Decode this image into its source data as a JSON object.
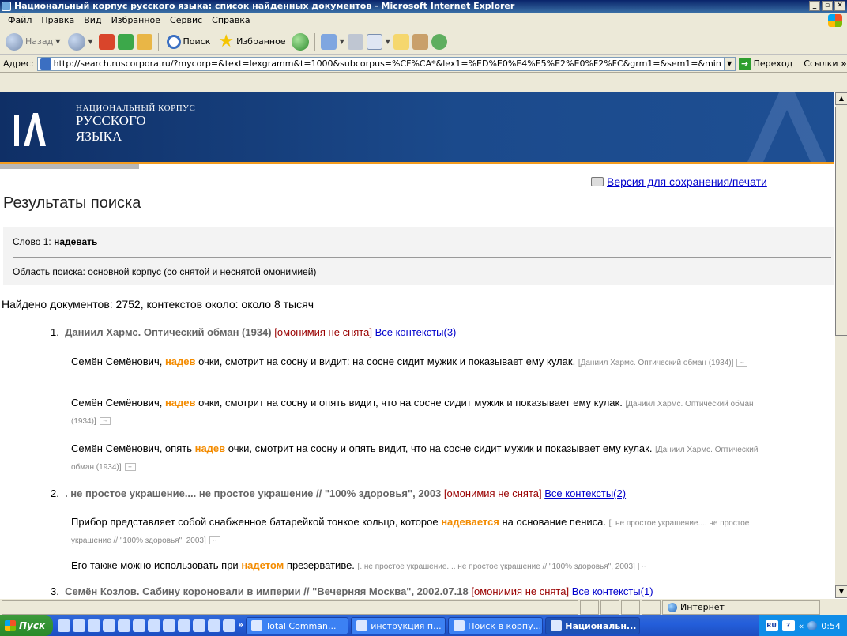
{
  "window": {
    "title": "Национальный корпус русского языка: список найденных документов - Microsoft Internet Explorer"
  },
  "menu": [
    "Файл",
    "Правка",
    "Вид",
    "Избранное",
    "Сервис",
    "Справка"
  ],
  "toolbar": {
    "back_label": "Назад",
    "search_label": "Поиск",
    "favorites_label": "Избранное"
  },
  "address": {
    "label": "Адрес:",
    "url": "http://search.ruscorpora.ru/?mycorp=&text=lexgramm&t=1000&subcorpus=%CF%CA*&lex1=%ED%E0%E4%E5%E2%E0%F2%FC&grm1=&sem1=&min",
    "go_label": "Переход",
    "links_label": "Ссылки"
  },
  "site": {
    "logo_line1": "НАЦИОНАЛЬНЫЙ КОРПУС",
    "logo_line2": "РУССКОГО",
    "logo_line3": "ЯЗЫКА",
    "print_link": "Версия для сохранения/печати",
    "results_title": "Результаты поиска",
    "query_word_prefix": "Слово 1:",
    "query_word": "надевать",
    "search_area": "Область поиска: основной корпус (со снятой и неснятой омонимией)",
    "found": "Найдено документов: 2752, контекстов около: около 8 тысяч"
  },
  "documents": [
    {
      "num": "1.",
      "title": "Даниил Хармс. Оптический обман (1934)",
      "source": "",
      "omonimia": "[омонимия не снята]",
      "all_contexts": "Все контексты(3)",
      "contexts": [
        {
          "before": "Семён Семёнович, ",
          "hit": "надев",
          "after": " очки, смотрит на сосну и видит: на сосне сидит мужик и показывает ему кулак.",
          "cite": "[Даниил Хармс. Оптический обман (1934)]"
        },
        {
          "before": "Семён Семёнович, ",
          "hit": "надев",
          "after": " очки, смотрит на сосну и опять видит, что на сосне сидит мужик и показывает ему кулак.",
          "cite": "[Даниил Хармс. Оптический обман (1934)]"
        },
        {
          "before": "Семён Семёнович, опять ",
          "hit": "надев",
          "after": " очки, смотрит на сосну и опять видит, что на сосне сидит мужик и показывает ему кулак.",
          "cite": "[Даниил Хармс. Оптический обман (1934)]"
        }
      ]
    },
    {
      "num": "2.",
      "title": ". не простое украшение.... не простое украшение",
      "source": " // \"100% здоровья\", 2003",
      "omonimia": "[омонимия не снята]",
      "all_contexts": "Все контексты(2)",
      "contexts": [
        {
          "before": "Прибор представляет собой снабженное батарейкой тонкое кольцо, которое ",
          "hit": "надевается",
          "after": " на основание пениса.",
          "cite": "[. не простое украшение.... не простое украшение // \"100% здоровья\", 2003]"
        },
        {
          "before": "Его также можно использовать при ",
          "hit": "надетом",
          "after": " презервативе.",
          "cite": "[. не простое украшение.... не простое украшение // \"100% здоровья\", 2003]"
        }
      ]
    },
    {
      "num": "3.",
      "title": "Семён Козлов. Сабину короновали в империи",
      "source": " // \"Вечерняя Москва\", 2002.07.18",
      "omonimia": "[омонимия не снята]",
      "all_contexts": "Все контексты(1)",
      "contexts": []
    }
  ],
  "status": {
    "zone": "Интернет"
  },
  "taskbar": {
    "start": "Пуск",
    "tasks": [
      "Total Comman...",
      "инструкция п...",
      "Поиск в корпу...",
      "Национальн..."
    ],
    "lang": "RU",
    "time": "0:54"
  }
}
